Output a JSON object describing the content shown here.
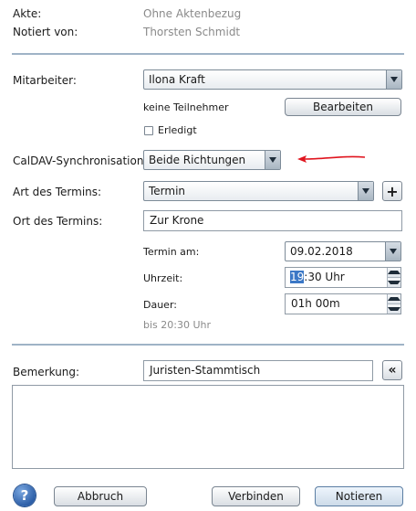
{
  "header": {
    "akte_label": "Akte:",
    "akte_value": "Ohne Aktenbezug",
    "notiert_label": "Notiert von:",
    "notiert_value": "Thorsten Schmidt"
  },
  "mitarbeiter": {
    "label": "Mitarbeiter:",
    "value": "Ilona Kraft",
    "participants": "keine Teilnehmer",
    "edit_button": "Bearbeiten",
    "done_label": "Erledigt",
    "done_checked": false
  },
  "caldav": {
    "label": "CalDAV-Synchronisation:",
    "value": "Beide Richtungen",
    "arrow_color": "#e0141e"
  },
  "termin": {
    "art_label": "Art des Termins:",
    "art_value": "Termin",
    "ort_label": "Ort des Termins:",
    "ort_value": "Zur Krone",
    "date_label": "Termin am:",
    "date_value": "09.02.2018",
    "time_label": "Uhrzeit:",
    "time_hour_selected": "19",
    "time_rest": ":30 Uhr",
    "duration_label": "Dauer:",
    "duration_value": "01h 00m",
    "until_text": "bis 20:30 Uhr"
  },
  "bemerkung": {
    "label": "Bemerkung:",
    "value": "Juristen-Stammtisch",
    "notes": ""
  },
  "footer": {
    "help": "?",
    "cancel": "Abbruch",
    "connect": "Verbinden",
    "save": "Notieren"
  },
  "colors": {
    "divider": "#9fb3c6",
    "selection": "#3b78c6"
  }
}
